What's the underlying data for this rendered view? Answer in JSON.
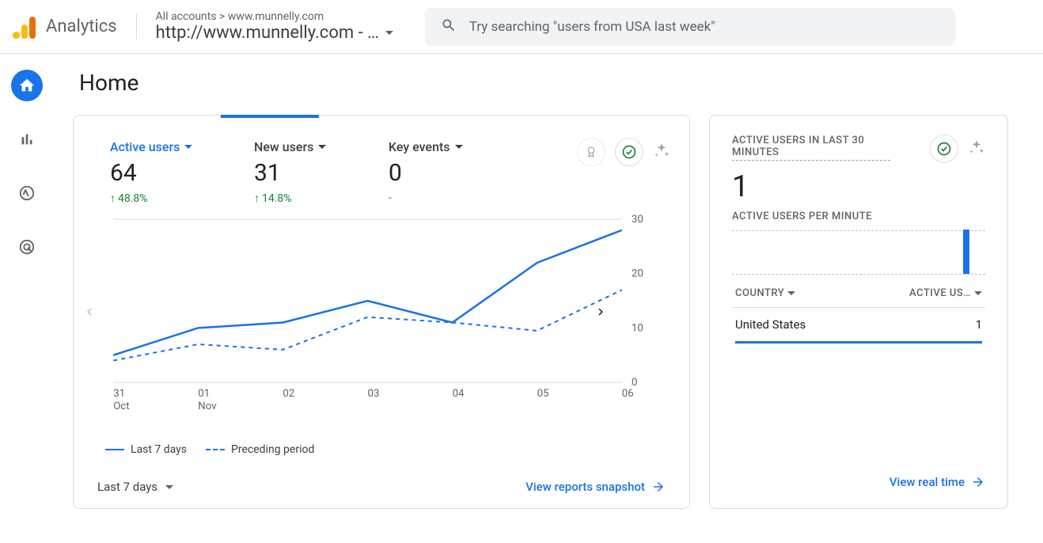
{
  "header": {
    "product": "Analytics",
    "breadcrumb": "All accounts > www.munnelly.com",
    "property": "http://www.munnelly.com - …",
    "search_placeholder": "Try searching \"users from USA last week\""
  },
  "page": {
    "title": "Home"
  },
  "metrics": [
    {
      "label": "Active users",
      "value": "64",
      "change": "48.8%",
      "change_dir": "up"
    },
    {
      "label": "New users",
      "value": "31",
      "change": "14.8%",
      "change_dir": "up"
    },
    {
      "label": "Key events",
      "value": "0",
      "change": "-"
    }
  ],
  "legend": {
    "current": "Last 7 days",
    "previous": "Preceding period"
  },
  "footer": {
    "date_range": "Last 7 days",
    "link": "View reports snapshot"
  },
  "realtime": {
    "title": "ACTIVE USERS IN LAST 30 MINUTES",
    "value": "1",
    "sub": "ACTIVE USERS PER MINUTE",
    "col_country": "COUNTRY",
    "col_users": "ACTIVE US…",
    "rows": [
      {
        "country": "United States",
        "users": "1"
      }
    ],
    "link": "View real time"
  },
  "chart_data": {
    "type": "line",
    "title": "Active users",
    "xlabel": "",
    "ylabel": "",
    "ylim": [
      0,
      30
    ],
    "x_ticks": [
      "31\nOct",
      "01\nNov",
      "02",
      "03",
      "04",
      "05",
      "06"
    ],
    "y_ticks": [
      0,
      10,
      20,
      30
    ],
    "series": [
      {
        "name": "Last 7 days",
        "values": [
          5,
          10,
          11,
          15,
          11,
          22,
          28
        ]
      },
      {
        "name": "Preceding period",
        "values": [
          4,
          7,
          6,
          12,
          11,
          9.5,
          17
        ]
      }
    ]
  }
}
